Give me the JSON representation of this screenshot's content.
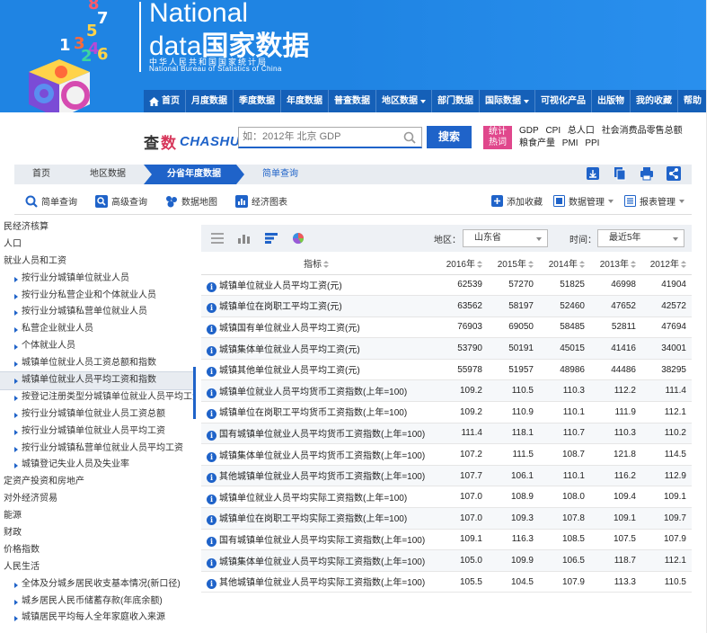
{
  "brand": {
    "line1": "National",
    "line2_en": "data",
    "line2_cn": "国家数据",
    "subtitle_cn": "中华人民共和国国家统计局",
    "subtitle_en": "National Bureau of Statistics of China",
    "logo_digits": [
      "8",
      "7",
      "5",
      "1",
      "3",
      "4",
      "2",
      "6"
    ]
  },
  "nav": {
    "items": [
      {
        "label": "首页",
        "icon": "home-icon"
      },
      {
        "label": "月度数据"
      },
      {
        "label": "季度数据"
      },
      {
        "label": "年度数据"
      },
      {
        "label": "普查数据"
      },
      {
        "label": "地区数据",
        "dropdown": true
      },
      {
        "label": "部门数据"
      },
      {
        "label": "国际数据",
        "dropdown": true
      },
      {
        "label": "可视化产品"
      },
      {
        "label": "出版物"
      },
      {
        "label": "我的收藏"
      },
      {
        "label": "帮助"
      }
    ]
  },
  "search": {
    "logo_cn_1": "查",
    "logo_cn_2": "数",
    "logo_en": "CHASHU",
    "placeholder": "如：2012年 北京 GDP",
    "button": "搜索",
    "hot_label_1": "统计",
    "hot_label_2": "热词",
    "hot_words": [
      "GDP",
      "CPI",
      "总人口",
      "社会消费品零售总额",
      "粮食产量",
      "PMI",
      "PPI"
    ]
  },
  "breadcrumb": {
    "items": [
      "首页",
      "地区数据",
      "分省年度数据",
      "简单查询"
    ]
  },
  "toolbar": {
    "left": [
      "简单查询",
      "高级查询",
      "数据地图",
      "经济图表"
    ],
    "right": [
      "添加收藏",
      "数据管理",
      "报表管理"
    ]
  },
  "tree": {
    "items": [
      {
        "label": "民经济核算",
        "level": 0
      },
      {
        "label": "人口",
        "level": 0
      },
      {
        "label": "就业人员和工资",
        "level": 0
      },
      {
        "label": "按行业分城镇单位就业人员",
        "level": 1
      },
      {
        "label": "按行业分私营企业和个体就业人员",
        "level": 1
      },
      {
        "label": "按行业分城镇私营单位就业人员",
        "level": 1
      },
      {
        "label": "私营企业就业人员",
        "level": 1
      },
      {
        "label": "个体就业人员",
        "level": 1
      },
      {
        "label": "城镇单位就业人员工资总额和指数",
        "level": 1
      },
      {
        "label": "城镇单位就业人员平均工资和指数",
        "level": 1,
        "selected": true
      },
      {
        "label": "按登记注册类型分城镇单位就业人员平均工资",
        "level": 1
      },
      {
        "label": "按行业分城镇单位就业人员工资总额",
        "level": 1
      },
      {
        "label": "按行业分城镇单位就业人员平均工资",
        "level": 1
      },
      {
        "label": "按行业分城镇私营单位就业人员平均工资",
        "level": 1
      },
      {
        "label": "城镇登记失业人员及失业率",
        "level": 1
      },
      {
        "label": "定资产投资和房地产",
        "level": 0
      },
      {
        "label": "对外经济贸易",
        "level": 0
      },
      {
        "label": "能源",
        "level": 0
      },
      {
        "label": "财政",
        "level": 0
      },
      {
        "label": "价格指数",
        "level": 0
      },
      {
        "label": "人民生活",
        "level": 0
      },
      {
        "label": "全体及分城乡居民收支基本情况(新口径)",
        "level": 1
      },
      {
        "label": "城乡居民人民币储蓄存款(年底余额)",
        "level": 1
      },
      {
        "label": "城镇居民平均每人全年家庭收入来源",
        "level": 1
      }
    ]
  },
  "filters": {
    "region_label": "地区：",
    "region_value": "山东省",
    "time_label": "时间：",
    "time_value": "最近5年"
  },
  "table": {
    "headers": [
      "指标",
      "2016年",
      "2015年",
      "2014年",
      "2013年",
      "2012年"
    ],
    "rows": [
      [
        "城镇单位就业人员平均工资(元)",
        "62539",
        "57270",
        "51825",
        "46998",
        "41904"
      ],
      [
        "城镇单位在岗职工平均工资(元)",
        "63562",
        "58197",
        "52460",
        "47652",
        "42572"
      ],
      [
        "城镇国有单位就业人员平均工资(元)",
        "76903",
        "69050",
        "58485",
        "52811",
        "47694"
      ],
      [
        "城镇集体单位就业人员平均工资(元)",
        "53790",
        "50191",
        "45015",
        "41416",
        "34001"
      ],
      [
        "城镇其他单位就业人员平均工资(元)",
        "55978",
        "51957",
        "48986",
        "44486",
        "38295"
      ],
      [
        "城镇单位就业人员平均货币工资指数(上年=100)",
        "109.2",
        "110.5",
        "110.3",
        "112.2",
        "111.4"
      ],
      [
        "城镇单位在岗职工平均货币工资指数(上年=100)",
        "109.2",
        "110.9",
        "110.1",
        "111.9",
        "112.1"
      ],
      [
        "国有城镇单位就业人员平均货币工资指数(上年=100)",
        "111.4",
        "118.1",
        "110.7",
        "110.3",
        "110.2"
      ],
      [
        "城镇集体单位就业人员平均货币工资指数(上年=100)",
        "107.2",
        "111.5",
        "108.7",
        "121.8",
        "114.5"
      ],
      [
        "其他城镇单位就业人员平均货币工资指数(上年=100)",
        "107.7",
        "106.1",
        "110.1",
        "116.2",
        "112.9"
      ],
      [
        "城镇单位就业人员平均实际工资指数(上年=100)",
        "107.0",
        "108.9",
        "108.0",
        "109.4",
        "109.1"
      ],
      [
        "城镇单位在岗职工平均实际工资指数(上年=100)",
        "107.0",
        "109.3",
        "107.8",
        "109.1",
        "109.7"
      ],
      [
        "国有城镇单位就业人员平均实际工资指数(上年=100)",
        "109.1",
        "116.3",
        "108.5",
        "107.5",
        "107.9"
      ],
      [
        "城镇集体单位就业人员平均实际工资指数(上年=100)",
        "105.0",
        "109.9",
        "106.5",
        "118.7",
        "112.1"
      ],
      [
        "其他城镇单位就业人员平均实际工资指数(上年=100)",
        "105.5",
        "104.5",
        "107.9",
        "113.3",
        "110.5"
      ]
    ]
  },
  "colors": {
    "banner": "#1f84e3",
    "nav": "#1560b8",
    "accent": "#1f63c9",
    "hot": "#e0478c"
  }
}
